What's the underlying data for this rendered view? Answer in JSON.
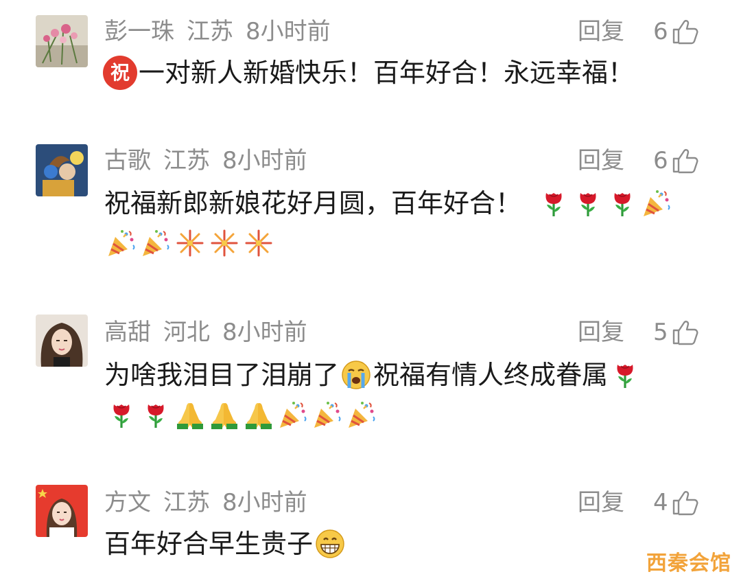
{
  "comments": [
    {
      "name": "彭一珠",
      "region": "江苏",
      "time": "8小时前",
      "reply_label": "回复",
      "likes": "6",
      "badge": "祝",
      "line1": "一对新人新婚快乐！百年好合！永远幸福！"
    },
    {
      "name": "古歌",
      "region": "江苏",
      "time": "8小时前",
      "reply_label": "回复",
      "likes": "6",
      "line1": "祝福新郎新娘花好月圆，百年好合！",
      "line1_emojis": [
        "rose-icon",
        "rose-icon",
        "rose-icon",
        "party-popper-icon"
      ],
      "line2_emojis": [
        "party-popper-icon",
        "party-popper-icon",
        "fireworks-icon",
        "fireworks-icon",
        "fireworks-icon"
      ]
    },
    {
      "name": "高甜",
      "region": "河北",
      "time": "8小时前",
      "reply_label": "回复",
      "likes": "5",
      "line1_a": "为啥我泪目了泪崩了",
      "line1_b": "祝福有情人终成眷属",
      "line1_emojis": [
        "crying-face-icon",
        "rose-icon"
      ],
      "line2_emojis": [
        "rose-icon",
        "rose-icon",
        "folded-hands-icon",
        "folded-hands-icon",
        "folded-hands-icon",
        "party-popper-icon",
        "party-popper-icon",
        "party-popper-icon"
      ]
    },
    {
      "name": "方文",
      "region": "江苏",
      "time": "8小时前",
      "reply_label": "回复",
      "likes": "4",
      "line1": "百年好合早生贵子",
      "line1_emojis": [
        "grinning-face-icon"
      ]
    }
  ],
  "watermark": "西秦会馆"
}
